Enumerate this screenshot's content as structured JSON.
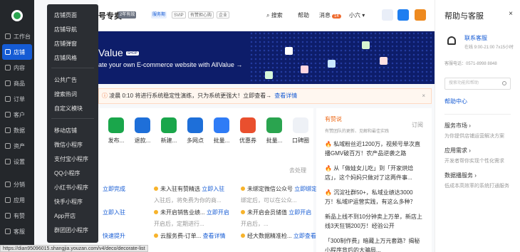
{
  "sidebar": {
    "items": [
      {
        "label": "工作台",
        "icon": "dashboard-icon"
      },
      {
        "label": "店铺",
        "icon": "shop-icon"
      },
      {
        "label": "内容",
        "icon": "content-icon"
      },
      {
        "label": "商品",
        "icon": "goods-icon"
      },
      {
        "label": "订单",
        "icon": "order-icon"
      },
      {
        "label": "客户",
        "icon": "customer-icon"
      },
      {
        "label": "数据",
        "icon": "data-icon"
      },
      {
        "label": "资产",
        "icon": "asset-icon"
      },
      {
        "label": "设置",
        "icon": "settings-icon"
      },
      {
        "label": "分销",
        "icon": "distribution-icon"
      },
      {
        "label": "应用",
        "icon": "apps-icon"
      },
      {
        "label": "有赞",
        "icon": "youzan-icon"
      },
      {
        "label": "客服",
        "icon": "service-icon"
      }
    ]
  },
  "submenu": {
    "group1": [
      "店铺页面",
      "店铺导航",
      "店铺弹窗",
      "店铺风格"
    ],
    "group2": [
      "公共广告",
      "搜索热词",
      "自定义模块"
    ],
    "group3": [
      "移动店铺",
      "微信小程序",
      "支付宝小程序",
      "QQ小程序",
      "小红书小程序",
      "快手小程序",
      "App开店",
      "群团团小程序"
    ]
  },
  "header": {
    "shop_name": "号专卖",
    "badges": [
      "2年有效",
      "服务期",
      "SVIP",
      "有赞担心购",
      "企业"
    ],
    "search": "搜索",
    "help": "帮助",
    "messages": "消息",
    "message_count": "14",
    "user": "小六"
  },
  "banner": {
    "logo": "Value",
    "shop_tag": "SHOP",
    "subtitle": "ate your own E-commerce website with AllValue →"
  },
  "notice": {
    "text": "凌晨 0:10 将进行系统稳定性演练，只为系统更强大！立即查看→",
    "link": "查看详情",
    "close": "×"
  },
  "tools": [
    {
      "label": "发布..."
    },
    {
      "label": "退款..."
    },
    {
      "label": "新建..."
    },
    {
      "label": "多网点"
    },
    {
      "label": "批量..."
    },
    {
      "label": "优惠券"
    },
    {
      "label": "批量..."
    },
    {
      "label": "口碑圈"
    }
  ],
  "todo": {
    "title": "去处理",
    "rows": [
      {
        "text": "立即完成",
        "link": true
      },
      {
        "text": "未入驻有赞精选 ",
        "link_text": "立即入驻",
        "sub": "入驻后，将免费为你的商..."
      },
      {
        "text": "未绑定微信公众号 ",
        "link_text": "立即绑定",
        "sub": "绑定后，可以在公众..."
      },
      {
        "text": "立即入驻",
        "link": true
      },
      {
        "text": "未开启销售业绩... ",
        "link_text": "立即开启",
        "sub": "开启后，定期进行..."
      },
      {
        "text": "未开启会员储值 ",
        "link_text": "立即开启",
        "sub": "开启后，..."
      },
      {
        "text": "快速提升",
        "link": true
      },
      {
        "text": "云服务费-订单... ",
        "link_text": "查看详情"
      },
      {
        "text": "经大数据精准检... ",
        "link_text": "立即查看"
      }
    ]
  },
  "news": {
    "title": "有赞说",
    "subtitle": "有赞团队的更新、见解和最佳实践",
    "more": "订阅",
    "items": [
      {
        "text": "私域粉丝近1200万，视频号单次直播GMV破百万！农产品逆袭之路",
        "hot": true
      },
      {
        "text": "从「做娃女儿吃」到「开家烘焙店」，这个妈妈只做对了这两件事...",
        "hot": true
      },
      {
        "text": "沉淀社群50+，私域业绩达3000万！私域IP运营实践，有这么多种？",
        "hot": true
      },
      {
        "text": "新品上线不到10分钟卖上万单，新店上线3天狂销200万！经验公开",
        "hot": false
      },
      {
        "text": "「300制作费」暗藏上万元套路？揭秘小程序背后的大骗局...",
        "hot": false
      }
    ]
  },
  "help_panel": {
    "title": "帮助与客服",
    "close": "×",
    "service_name": "联系客服",
    "service_hours": "在线 9:00-21:00 7x15小时",
    "phone": "客服电话：0571-8998 8848",
    "search_placeholder": "搜索功能和帮助",
    "center": "帮助中心",
    "sections": [
      {
        "title": "服务市场 ›",
        "desc": "为你提供店铺运营解决方案"
      },
      {
        "title": "应用需求 ›",
        "desc": "开发者帮你实现个性化需求"
      },
      {
        "title": "数据播服务 ›",
        "desc": "低成本高效率的系统打通服务"
      }
    ]
  },
  "status_url": "https://dian95096015.shangjia.youzan.com/v4/deco/decorate-list"
}
